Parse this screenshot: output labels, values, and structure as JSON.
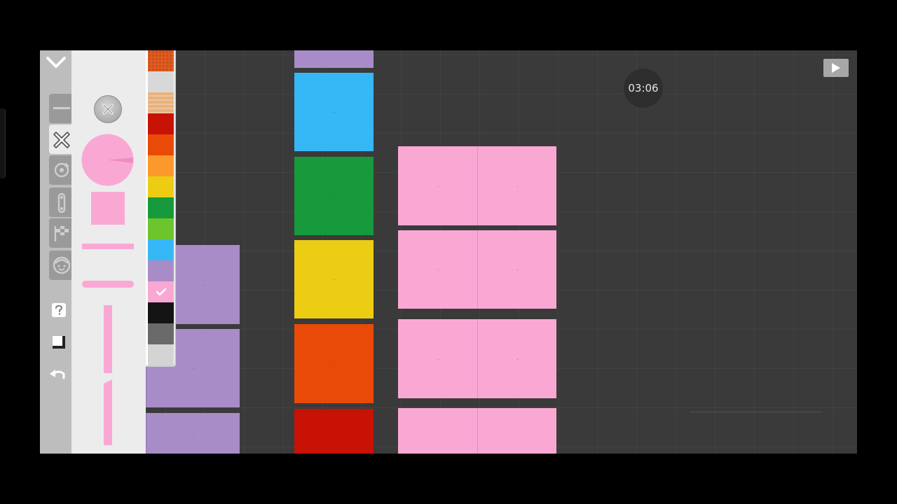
{
  "hud": {
    "timer": "03:06"
  },
  "icons": {
    "collapse": "chevron-down-icon",
    "play": "play-icon",
    "close": "close-icon",
    "help": "help-icon",
    "square": "square-icon",
    "undo": "undo-icon"
  },
  "tools": [
    {
      "name": "line-tool",
      "icon": "line-icon",
      "active": false
    },
    {
      "name": "move-tool",
      "icon": "move-cross-icon",
      "active": true
    },
    {
      "name": "rotate-tool",
      "icon": "rotate-icon",
      "active": false
    },
    {
      "name": "joint-tool",
      "icon": "joint-icon",
      "active": false
    },
    {
      "name": "goal-tool",
      "icon": "checkered-flag-icon",
      "active": false
    },
    {
      "name": "character-tool",
      "icon": "face-icon",
      "active": false
    }
  ],
  "colors": {
    "selected": "#f9a8d4",
    "swatches": [
      "#e05a1f",
      "#d8d8d8",
      "#e9b27c",
      "#c81206",
      "#ea4a08",
      "#fb9a2a",
      "#eccd14",
      "#169a3c",
      "#6cc52c",
      "#36b7f6",
      "#a88cc8",
      "#f9a8d4",
      "#141414",
      "#6a6a6a",
      "#d4d4d4"
    ]
  },
  "blocks": {
    "purple": "#a88cc8",
    "blue": "#36b7f6",
    "green": "#169a3c",
    "yellow": "#eccd14",
    "orange": "#ea4a08",
    "red": "#c81206",
    "pink": "#f9a8d4"
  }
}
